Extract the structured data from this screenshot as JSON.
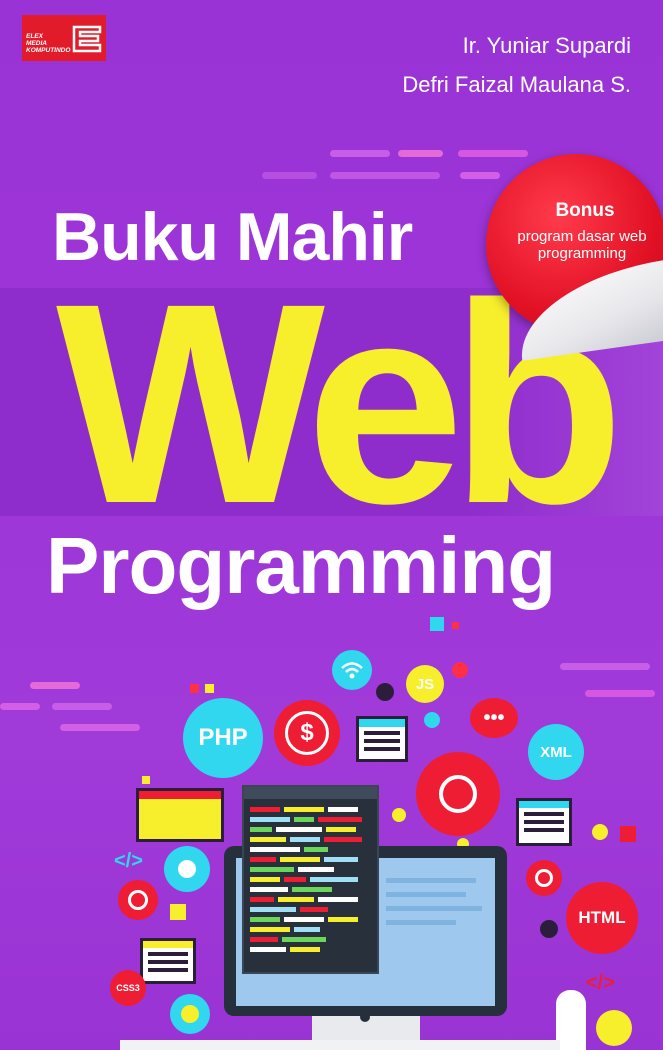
{
  "publisher": {
    "line1": "ELEX",
    "line2": "MEDIA",
    "line3": "KOMPUTINDO"
  },
  "authors": [
    "Ir. Yuniar Supardi",
    "Defri Faizal Maulana S."
  ],
  "title": {
    "line1": "Buku Mahir",
    "line2": "Web",
    "line3": "Programming"
  },
  "badge": {
    "heading": "Bonus",
    "line1": "program dasar web",
    "line2": "programming"
  },
  "icons": {
    "php": "PHP",
    "js": "JS",
    "xml": "XML",
    "html": "HTML",
    "css": "CSS3",
    "tag": "</>",
    "tag2": "</>"
  },
  "colors": {
    "background": "#9b34d8",
    "accent_yellow": "#f7ee2c",
    "badge_red": "#e21125"
  }
}
